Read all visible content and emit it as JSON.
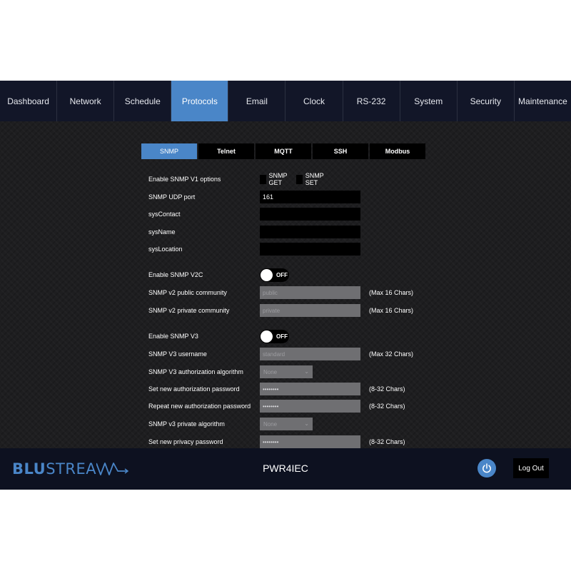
{
  "nav": {
    "items": [
      "Dashboard",
      "Network",
      "Schedule",
      "Protocols",
      "Email",
      "Clock",
      "RS-232",
      "System",
      "Security",
      "Maintenance"
    ],
    "active": "Protocols"
  },
  "subtabs": {
    "items": [
      "SNMP",
      "Telnet",
      "MQTT",
      "SSH",
      "Modbus"
    ],
    "active": "SNMP"
  },
  "form": {
    "v1_options": {
      "label": "Enable SNMP V1 options",
      "get_label": "SNMP GET",
      "set_label": "SNMP SET"
    },
    "udp_port": {
      "label": "SNMP UDP port",
      "value": "161"
    },
    "sys_contact": {
      "label": "sysContact",
      "value": ""
    },
    "sys_name": {
      "label": "sysName",
      "value": ""
    },
    "sys_location": {
      "label": "sysLocation",
      "value": ""
    },
    "v2c": {
      "label": "Enable SNMP V2C",
      "state": "OFF"
    },
    "v2_public": {
      "label": "SNMP v2 public community",
      "placeholder": "public",
      "hint": "(Max 16 Chars)"
    },
    "v2_private": {
      "label": "SNMP v2 private community",
      "placeholder": "private",
      "hint": "(Max 16 Chars)"
    },
    "v3": {
      "label": "Enable SNMP V3",
      "state": "OFF"
    },
    "v3_username": {
      "label": "SNMP V3 username",
      "placeholder": "standard",
      "hint": "(Max 32 Chars)"
    },
    "v3_auth_algo": {
      "label": "SNMP V3 authorization algorithm",
      "value": "None"
    },
    "auth_password": {
      "label": "Set new authorization password",
      "value": "••••••••",
      "hint": "(8-32 Chars)"
    },
    "auth_password_repeat": {
      "label": "Repeat new authorization password",
      "value": "••••••••",
      "hint": "(8-32 Chars)"
    },
    "v3_priv_algo": {
      "label": "SNMP v3 private algorithm",
      "value": "None"
    },
    "priv_password": {
      "label": "Set new privacy password",
      "value": "••••••••",
      "hint": "(8-32 Chars)"
    }
  },
  "footer": {
    "logo_blu": "BLU",
    "logo_strea": "STREA",
    "device_name": "PWR4IEC",
    "logout_label": "Log Out",
    "power_icon": "power-icon"
  },
  "colors": {
    "accent": "#4a86c8",
    "nav_bg": "#121628",
    "footer_bg": "#0d1120",
    "disabled_field": "#6f6f72"
  }
}
